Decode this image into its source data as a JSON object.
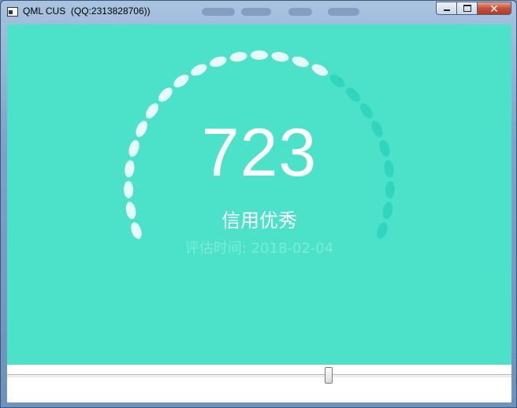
{
  "window": {
    "title": "QML CUS  (QQ:2313828706))"
  },
  "caption_buttons": {
    "minimize_glyph": "minimize-icon",
    "maximize_glyph": "maximize-icon",
    "close_label": "✕"
  },
  "gauge": {
    "score": "723",
    "level_text": "信用优秀",
    "eval_date_text": "评估时间: 2018-02-04",
    "score_min": 350,
    "score_max": 950,
    "score_value": 723,
    "dot_count": 25,
    "active_dot_color": "#e6fbf6",
    "inactive_dot_color": "#2fd6bd",
    "background_color": "#4ce2ca"
  },
  "slider": {
    "value_fraction": 0.64
  }
}
